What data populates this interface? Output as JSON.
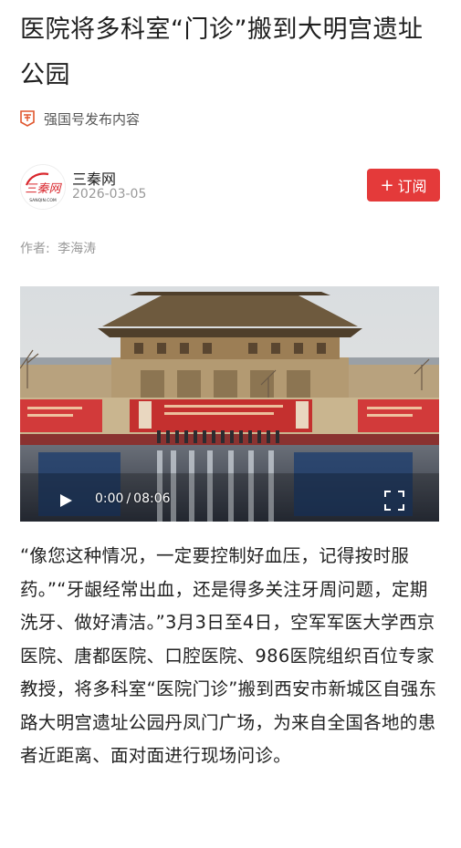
{
  "article": {
    "title": "医院将多科室“门诊”搬到大明宫遗址公园",
    "source_label": "强国号发布内容",
    "source_icon": "qiangguo-badge-icon",
    "author": {
      "name": "三秦网",
      "date": "2026-03-05",
      "avatar_text": "三秦网",
      "avatar_sub": "SANQIN.COM"
    },
    "subscribe_label": "订阅",
    "byline_label": "作者:",
    "byline_name": "李海涛",
    "video": {
      "current_time": "0:00",
      "separator": "/",
      "duration": "08:06",
      "progress": 0
    },
    "body": "“像您这种情况，一定要控制好血压，记得按时服药。”“牙龈经常出血，还是得多关注牙周问题，定期洗牙、做好清洁。”3月3日至4日，空军军医大学西京医院、唐都医院、口腔医院、986医院组织百位专家教授，将多科室“医院门诊”搬到西安市新城区自强东路大明宫遗址公园丹凤门广场，为来自全国各地的患者近距离、面对面进行现场问诊。"
  },
  "colors": {
    "accent": "#e43a3a",
    "muted": "#999999",
    "text": "#222222"
  }
}
